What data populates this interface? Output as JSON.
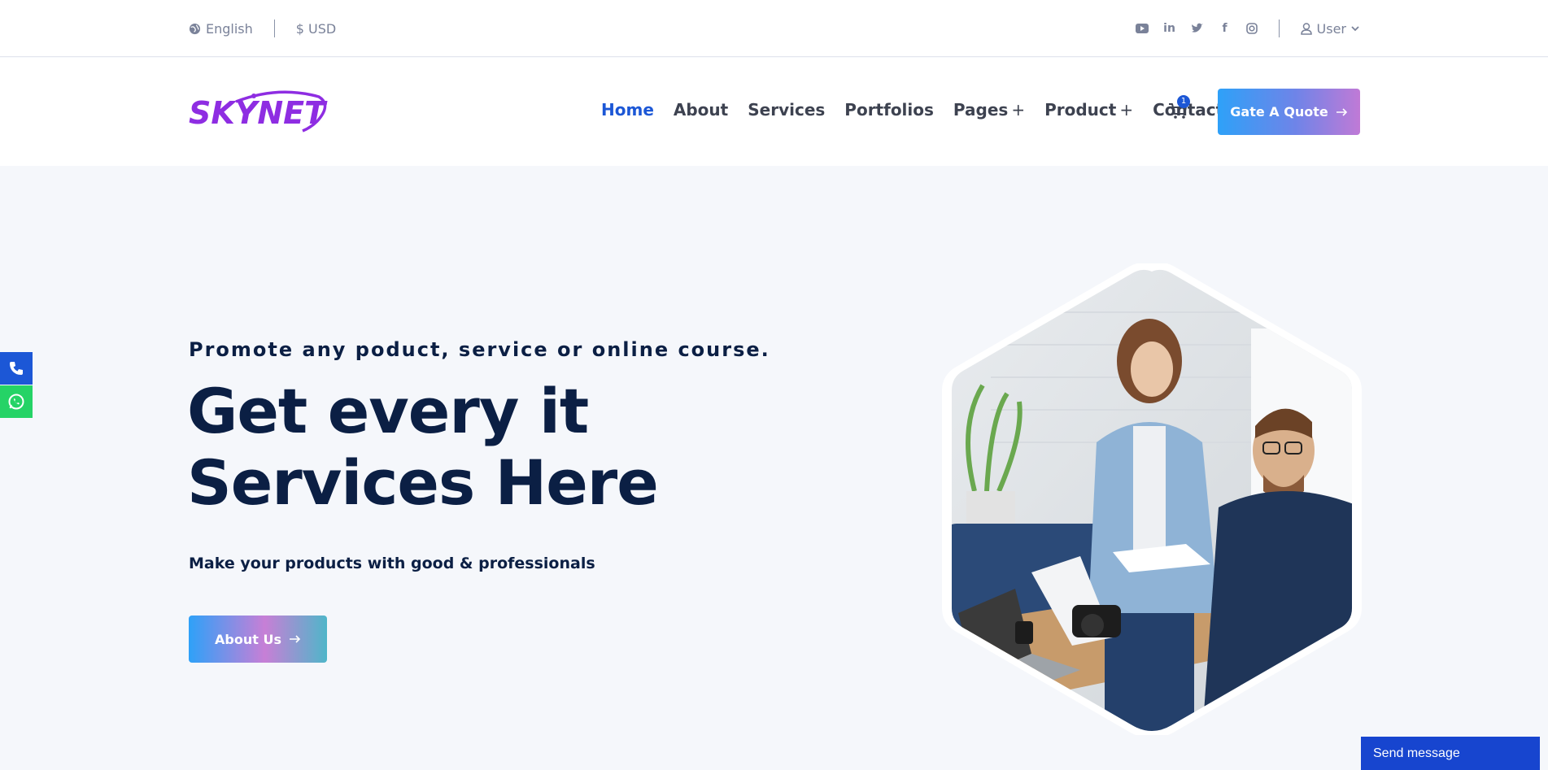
{
  "topbar": {
    "language": "English",
    "currency": "$ USD",
    "social": [
      "youtube-icon",
      "linkedin-icon",
      "twitter-icon",
      "facebook-icon",
      "instagram-icon"
    ],
    "user_label": "User"
  },
  "header": {
    "logo_text": "SKYNET",
    "nav": [
      {
        "label": "Home",
        "active": true
      },
      {
        "label": "About"
      },
      {
        "label": "Services"
      },
      {
        "label": "Portfolios"
      },
      {
        "label": "Pages",
        "has_submenu": true
      },
      {
        "label": "Product",
        "has_submenu": true
      },
      {
        "label": "Contact"
      }
    ],
    "cart_count": "1",
    "quote_button": "Gate A Quote"
  },
  "hero": {
    "tagline": "Promote any poduct, service or online course.",
    "headline_line1": "Get every it",
    "headline_line2": "Services Here",
    "subline": "Make your products with good & professionals",
    "cta": "About Us"
  },
  "floating": {
    "send_message": "Send message"
  },
  "colors": {
    "primary": "#1c57d6",
    "dark_text": "#0b1f44",
    "logo_purple": "#8e2de2",
    "whatsapp": "#25d366"
  }
}
